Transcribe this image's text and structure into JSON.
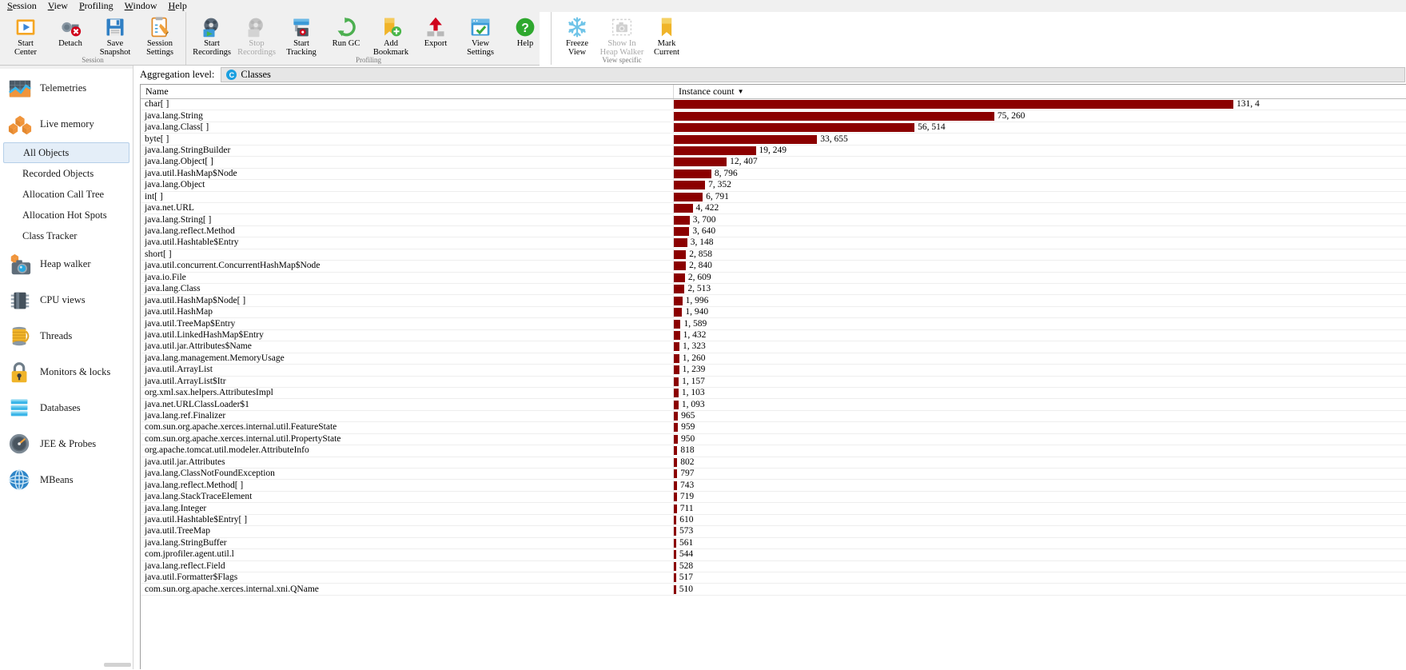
{
  "menubar": {
    "items": [
      {
        "mnemonic": "S",
        "rest": "ession"
      },
      {
        "mnemonic": "V",
        "rest": "iew"
      },
      {
        "mnemonic": "P",
        "rest": "rofiling"
      },
      {
        "mnemonic": "W",
        "rest": "indow"
      },
      {
        "mnemonic": "H",
        "rest": "elp"
      }
    ]
  },
  "toolbar": {
    "groups": [
      {
        "label": "Session",
        "buttons": [
          {
            "caption": "Start\nCenter",
            "icon": "start-center-icon",
            "enabled": true
          },
          {
            "caption": "Detach",
            "icon": "detach-icon",
            "enabled": true
          },
          {
            "caption": "Save\nSnapshot",
            "icon": "save-snapshot-icon",
            "enabled": true
          },
          {
            "caption": "Session\nSettings",
            "icon": "session-settings-icon",
            "enabled": true
          }
        ]
      },
      {
        "label": "Profiling",
        "buttons": [
          {
            "caption": "Start\nRecordings",
            "icon": "start-recordings-icon",
            "enabled": true
          },
          {
            "caption": "Stop\nRecordings",
            "icon": "stop-recordings-icon",
            "enabled": false
          },
          {
            "caption": "Start\nTracking",
            "icon": "start-tracking-icon",
            "enabled": true
          },
          {
            "caption": "Run GC",
            "icon": "run-gc-icon",
            "enabled": true
          },
          {
            "caption": "Add\nBookmark",
            "icon": "add-bookmark-icon",
            "enabled": true
          },
          {
            "caption": "Export",
            "icon": "export-icon",
            "enabled": true
          },
          {
            "caption": "View\nSettings",
            "icon": "view-settings-icon",
            "enabled": true
          },
          {
            "caption": "Help",
            "icon": "help-icon",
            "enabled": true
          }
        ]
      },
      {
        "label": "View specific",
        "buttons": [
          {
            "caption": "Freeze\nView",
            "icon": "freeze-view-icon",
            "enabled": true
          },
          {
            "caption": "Show In\nHeap Walker",
            "icon": "show-in-heap-walker-icon",
            "enabled": false
          },
          {
            "caption": "Mark\nCurrent",
            "icon": "mark-current-icon",
            "enabled": true
          }
        ]
      }
    ]
  },
  "sidebar": {
    "sections": [
      {
        "type": "category",
        "label": "Telemetries",
        "icon": "telemetries-icon"
      },
      {
        "type": "category",
        "label": "Live memory",
        "icon": "live-memory-icon"
      },
      {
        "type": "sub",
        "label": "All Objects",
        "selected": true
      },
      {
        "type": "sub",
        "label": "Recorded Objects",
        "selected": false
      },
      {
        "type": "sub",
        "label": "Allocation Call Tree",
        "selected": false
      },
      {
        "type": "sub",
        "label": "Allocation Hot Spots",
        "selected": false
      },
      {
        "type": "sub",
        "label": "Class Tracker",
        "selected": false
      },
      {
        "type": "category",
        "label": "Heap walker",
        "icon": "heap-walker-icon"
      },
      {
        "type": "category",
        "label": "CPU views",
        "icon": "cpu-views-icon"
      },
      {
        "type": "category",
        "label": "Threads",
        "icon": "threads-icon"
      },
      {
        "type": "category",
        "label": "Monitors & locks",
        "icon": "monitors-locks-icon"
      },
      {
        "type": "category",
        "label": "Databases",
        "icon": "databases-icon"
      },
      {
        "type": "category",
        "label": "JEE & Probes",
        "icon": "jee-probes-icon"
      },
      {
        "type": "category",
        "label": "MBeans",
        "icon": "mbeans-icon"
      }
    ]
  },
  "aggregation": {
    "label": "Aggregation level:",
    "badge": "C",
    "value": "Classes"
  },
  "table": {
    "columns": [
      "Name",
      "Instance count"
    ],
    "sorted_column": "Instance count",
    "sort_direction": "descending",
    "bar_color": "#8b0000",
    "rows": [
      {
        "name": "char[ ]",
        "count": 131400,
        "display": "131, 4"
      },
      {
        "name": "java.lang.String",
        "count": 75260,
        "display": "75, 260"
      },
      {
        "name": "java.lang.Class[ ]",
        "count": 56514,
        "display": "56, 514"
      },
      {
        "name": "byte[ ]",
        "count": 33655,
        "display": "33, 655"
      },
      {
        "name": "java.lang.StringBuilder",
        "count": 19249,
        "display": "19, 249"
      },
      {
        "name": "java.lang.Object[ ]",
        "count": 12407,
        "display": "12, 407"
      },
      {
        "name": "java.util.HashMap$Node",
        "count": 8796,
        "display": "8, 796"
      },
      {
        "name": "java.lang.Object",
        "count": 7352,
        "display": "7, 352"
      },
      {
        "name": "int[ ]",
        "count": 6791,
        "display": "6, 791"
      },
      {
        "name": "java.net.URL",
        "count": 4422,
        "display": "4, 422"
      },
      {
        "name": "java.lang.String[ ]",
        "count": 3700,
        "display": "3, 700"
      },
      {
        "name": "java.lang.reflect.Method",
        "count": 3640,
        "display": "3, 640"
      },
      {
        "name": "java.util.Hashtable$Entry",
        "count": 3148,
        "display": "3, 148"
      },
      {
        "name": "short[ ]",
        "count": 2858,
        "display": "2, 858"
      },
      {
        "name": "java.util.concurrent.ConcurrentHashMap$Node",
        "count": 2840,
        "display": "2, 840"
      },
      {
        "name": "java.io.File",
        "count": 2609,
        "display": "2, 609"
      },
      {
        "name": "java.lang.Class",
        "count": 2513,
        "display": "2, 513"
      },
      {
        "name": "java.util.HashMap$Node[ ]",
        "count": 1996,
        "display": "1, 996"
      },
      {
        "name": "java.util.HashMap",
        "count": 1940,
        "display": "1, 940"
      },
      {
        "name": "java.util.TreeMap$Entry",
        "count": 1589,
        "display": "1, 589"
      },
      {
        "name": "java.util.LinkedHashMap$Entry",
        "count": 1432,
        "display": "1, 432"
      },
      {
        "name": "java.util.jar.Attributes$Name",
        "count": 1323,
        "display": "1, 323"
      },
      {
        "name": "java.lang.management.MemoryUsage",
        "count": 1260,
        "display": "1, 260"
      },
      {
        "name": "java.util.ArrayList",
        "count": 1239,
        "display": "1, 239"
      },
      {
        "name": "java.util.ArrayList$Itr",
        "count": 1157,
        "display": "1, 157"
      },
      {
        "name": "org.xml.sax.helpers.AttributesImpl",
        "count": 1103,
        "display": "1, 103"
      },
      {
        "name": "java.net.URLClassLoader$1",
        "count": 1093,
        "display": "1, 093"
      },
      {
        "name": "java.lang.ref.Finalizer",
        "count": 965,
        "display": "965"
      },
      {
        "name": "com.sun.org.apache.xerces.internal.util.FeatureState",
        "count": 959,
        "display": "959"
      },
      {
        "name": "com.sun.org.apache.xerces.internal.util.PropertyState",
        "count": 950,
        "display": "950"
      },
      {
        "name": "org.apache.tomcat.util.modeler.AttributeInfo",
        "count": 818,
        "display": "818"
      },
      {
        "name": "java.util.jar.Attributes",
        "count": 802,
        "display": "802"
      },
      {
        "name": "java.lang.ClassNotFoundException",
        "count": 797,
        "display": "797"
      },
      {
        "name": "java.lang.reflect.Method[ ]",
        "count": 743,
        "display": "743"
      },
      {
        "name": "java.lang.StackTraceElement",
        "count": 719,
        "display": "719"
      },
      {
        "name": "java.lang.Integer",
        "count": 711,
        "display": "711"
      },
      {
        "name": "java.util.Hashtable$Entry[ ]",
        "count": 610,
        "display": "610"
      },
      {
        "name": "java.util.TreeMap",
        "count": 573,
        "display": "573"
      },
      {
        "name": "java.lang.StringBuffer",
        "count": 561,
        "display": "561"
      },
      {
        "name": "com.jprofiler.agent.util.l",
        "count": 544,
        "display": "544"
      },
      {
        "name": "java.lang.reflect.Field",
        "count": 528,
        "display": "528"
      },
      {
        "name": "java.util.Formatter$Flags",
        "count": 517,
        "display": "517"
      },
      {
        "name": "com.sun.org.apache.xerces.internal.xni.QName",
        "count": 510,
        "display": "510"
      }
    ]
  }
}
